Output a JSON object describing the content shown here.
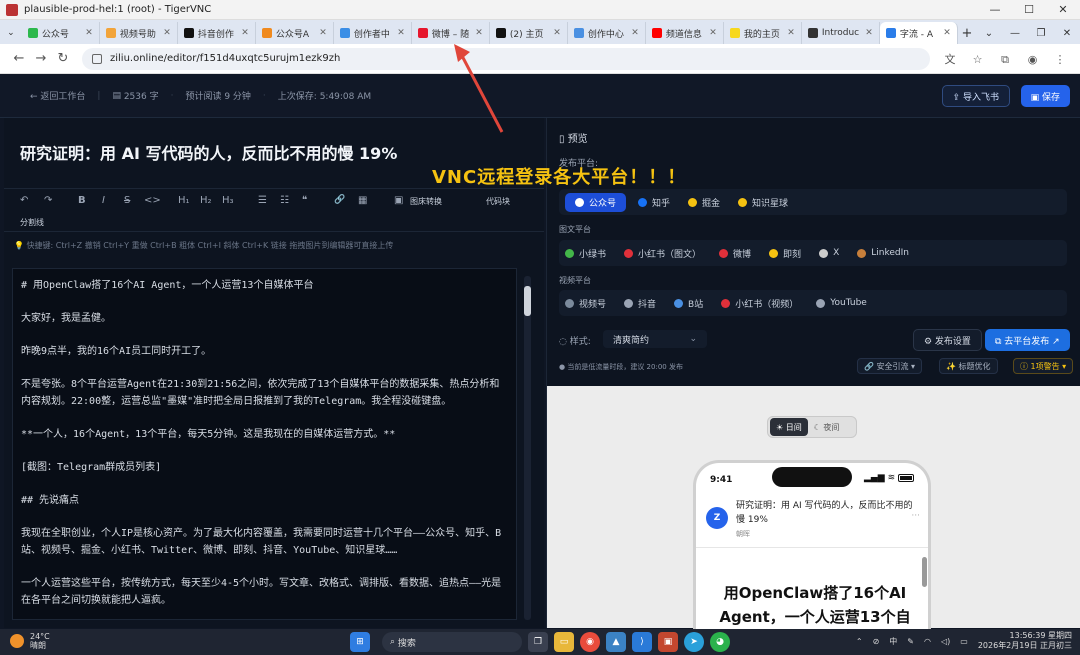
{
  "window": {
    "title": "plausible-prod-hel:1 (root) - TigerVNC",
    "minimize": "—",
    "maximize": "☐",
    "close": "✕"
  },
  "tabs": [
    {
      "label": "公众号",
      "color": "#2db84d"
    },
    {
      "label": "视频号助",
      "color": "#f2a43a"
    },
    {
      "label": "抖音创作",
      "color": "#111111"
    },
    {
      "label": "公众号A",
      "color": "#f08a1e"
    },
    {
      "label": "创作者中",
      "color": "#3a8ee6"
    },
    {
      "label": "微博 – 随",
      "color": "#e6162d"
    },
    {
      "label": "(2) 主页",
      "color": "#111111"
    },
    {
      "label": "创作中心",
      "color": "#4a90e2"
    },
    {
      "label": "频道信息",
      "color": "#ff0000"
    },
    {
      "label": "我的主页",
      "color": "#f7d81e"
    },
    {
      "label": "Introduc",
      "color": "#333333"
    },
    {
      "label": "字流 - A",
      "color": "#2b7de9",
      "active": true
    }
  ],
  "address": {
    "url": "ziliu.online/editor/f151d4uxqtc5urujm1ezk9zh"
  },
  "header": {
    "back": "← 返回工作台",
    "word_count": "2536 字",
    "read_time": "预计阅读 9 分钟",
    "last_saved": "上次保存: 5:49:08 AM",
    "import_btn": "⇪ 导入飞书",
    "save_btn": "▣ 保存"
  },
  "editor": {
    "title": "研究证明：用 AI 写代码的人，反而比不用的慢 19%",
    "toolbar": {
      "undo": "↶",
      "redo": "↷",
      "bold": "B",
      "italic": "I",
      "strike": "S",
      "code": "<>",
      "h1": "H₁",
      "h2": "H₂",
      "h3": "H₃",
      "ul": "☰",
      "ol": "☷",
      "quote": "❝",
      "link": "🔗",
      "table": "▦",
      "image": "▣",
      "convert": "图床转换",
      "codeblock": "代码块",
      "divider": "分割线"
    },
    "hint": "💡 快捷键: Ctrl+Z 撤销  Ctrl+Y 重做  Ctrl+B 粗体  Ctrl+I 斜体  Ctrl+K 链接  拖拽图片到编辑器可直接上传",
    "paragraphs": [
      "# 用OpenClaw搭了16个AI Agent，一个人运营13个自媒体平台",
      "大家好，我是孟健。",
      "昨晚9点半，我的16个AI员工同时开工了。",
      "不是夸张。8个平台运营Agent在21:30到21:56之间，依次完成了13个自媒体平台的数据采集、热点分析和内容规划。22:00整，运营总监\"墨媒\"准时把全局日报推到了我的Telegram。我全程没碰键盘。",
      "**一个人，16个Agent，13个平台，每天5分钟。这是我现在的自媒体运营方式。**",
      "[截图：Telegram群成员列表]",
      "## 先说痛点",
      "我现在全职创业，个人IP是核心资产。为了最大化内容覆盖，我需要同时运营十几个平台——公众号、知乎、B站、视频号、掘金、小红书、Twitter、微博、即刻、抖音、YouTube、知识星球……",
      "一个人运营这些平台，按传统方式，每天至少4-5个小时。写文章、改格式、调排版、看数据、追热点——光是在各平台之间切换就能把人逼疯。"
    ]
  },
  "preview": {
    "header": "预览",
    "platform_label": "发布平台:",
    "long_platforms": [
      {
        "label": "公众号",
        "color": "#ffffff",
        "selected": true
      },
      {
        "label": "知乎",
        "color": "#1772f6"
      },
      {
        "label": "掘金",
        "color": "#f5c211"
      },
      {
        "label": "知识星球",
        "color": "#f5c211"
      }
    ],
    "image_text_label": "图文平台",
    "image_text_platforms": [
      {
        "label": "小绿书",
        "color": "#43b649"
      },
      {
        "label": "小红书（图文）",
        "color": "#e0303a"
      },
      {
        "label": "微博",
        "color": "#e0303a"
      },
      {
        "label": "即刻",
        "color": "#f5c211"
      },
      {
        "label": "X",
        "color": "#cccccc"
      },
      {
        "label": "LinkedIn",
        "color": "#c77f3b"
      }
    ],
    "video_label": "视频平台",
    "video_platforms": [
      {
        "label": "视频号",
        "color": "#7b8a9c"
      },
      {
        "label": "抖音",
        "color": "#9aa4b4"
      },
      {
        "label": "B站",
        "color": "#4a90e2"
      },
      {
        "label": "小红书（视频）",
        "color": "#e0303a"
      },
      {
        "label": "YouTube",
        "color": "#9aa4b4"
      }
    ],
    "style_label": "样式:",
    "style_value": "清爽简约",
    "publish_settings": "⚙ 发布设置",
    "go_publish": "⧉ 去平台发布 ↗",
    "notice": "● 当前是低流量时段，建议 20:00 发布",
    "safety": "🔗 安全引流 ▾",
    "title_opt": "✨ 标题优化",
    "warning": "ⓘ 1项警告 ▾",
    "mode_day": "☀ 日间",
    "mode_night": "☾ 夜间",
    "phone": {
      "time": "9:41",
      "status": "▂▄▆ ≋",
      "avatar": "Z",
      "article_title": "研究证明：用 AI 写代码的人，反而比不用的慢 19%",
      "author": "朝晖",
      "dots": "···",
      "heading": "用OpenClaw搭了16个AI Agent，一个人运营13个自"
    }
  },
  "annotation": "VNC远程登录各大平台！！！",
  "taskbar": {
    "temp": "24°C",
    "weather": "晴朗",
    "search": "搜索",
    "ime": "中",
    "time": "13:56:39 星期四",
    "date": "2026年2月19日 正月初三"
  }
}
